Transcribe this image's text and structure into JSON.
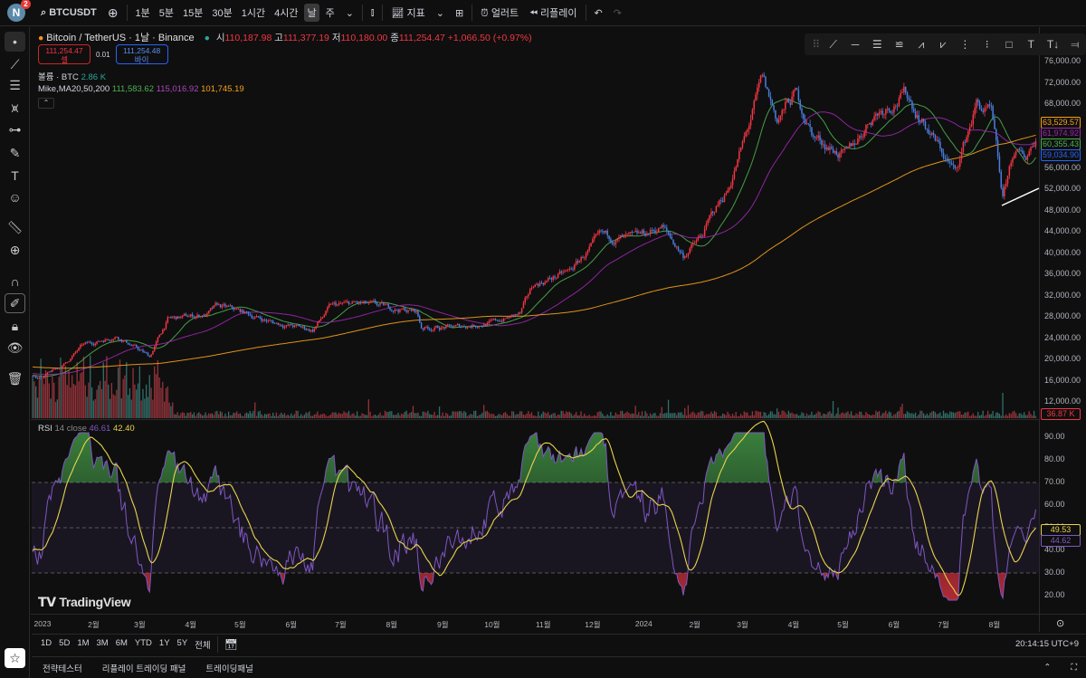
{
  "topbar": {
    "avatar_letter": "N",
    "notification_count": "2",
    "symbol": "BTCUSDT",
    "intervals": [
      "1분",
      "5분",
      "15분",
      "30분",
      "1시간",
      "4시간",
      "날",
      "주"
    ],
    "active_interval": "날",
    "indicators_label": "지표",
    "alert_label": "얼러트",
    "replay_label": "리플레이"
  },
  "legend": {
    "title": "Bitcoin / TetherUS · 1날 · Binance",
    "o_label": "시",
    "o": "110,187.98",
    "h_label": "고",
    "h": "111,377.19",
    "l_label": "저",
    "l": "110,180.00",
    "c_label": "종",
    "c": "111,254.47",
    "change": "+1,066.50 (+0.97%)",
    "sell_price": "111,254.47",
    "sell_label": "셀",
    "spread": "0.01",
    "buy_price": "111,254.48",
    "buy_label": "바이",
    "volume_label": "볼륨 · BTC",
    "volume_value": "2.86 K",
    "ma_label": "Mike,MA20,50,200",
    "ma20": "111,583.62",
    "ma50": "115,016.92",
    "ma200": "101,745.19",
    "rsi_label": "RSI",
    "rsi_params": "14 close",
    "rsi_value": "46.61",
    "rsi_ma_value": "42.40"
  },
  "price_axis": {
    "ticks": [
      "76,000.00",
      "72,000.00",
      "68,000.00",
      "64,000.00",
      "60,000.00",
      "56,000.00",
      "52,000.00",
      "48,000.00",
      "44,000.00",
      "40,000.00",
      "36,000.00",
      "32,000.00",
      "28,000.00",
      "24,000.00",
      "20,000.00",
      "16,000.00",
      "12,000.00"
    ],
    "tick_values": [
      76000,
      72000,
      68000,
      64000,
      60000,
      56000,
      52000,
      48000,
      44000,
      40000,
      36000,
      32000,
      28000,
      24000,
      20000,
      16000,
      12000
    ],
    "tags": [
      {
        "label": "63,529.57",
        "value": 63529.57,
        "color": "#f7a21b"
      },
      {
        "label": "61,974.92",
        "value": 61974.92,
        "color": "#9c27b0"
      },
      {
        "label": "60,355.43",
        "value": 60355.43,
        "color": "#4caf50"
      },
      {
        "label": "59,034.90",
        "value": 59034.9,
        "color": "#2962ff"
      }
    ],
    "volume_tag": "36.87 K"
  },
  "rsi_axis": {
    "ticks": [
      "90.00",
      "80.00",
      "70.00",
      "60.00",
      "50.00",
      "40.00",
      "30.00",
      "20.00"
    ],
    "tick_values": [
      90,
      80,
      70,
      60,
      50,
      40,
      30,
      20
    ],
    "tag_ma": "49.53",
    "tag_rsi": "44.62"
  },
  "time_axis": [
    {
      "label": "2023",
      "date": "2023-01-01"
    },
    {
      "label": "2월",
      "date": "2023-02-01"
    },
    {
      "label": "3월",
      "date": "2023-03-01"
    },
    {
      "label": "4월",
      "date": "2023-04-01"
    },
    {
      "label": "5월",
      "date": "2023-05-01"
    },
    {
      "label": "6월",
      "date": "2023-06-01"
    },
    {
      "label": "7월",
      "date": "2023-07-01"
    },
    {
      "label": "8월",
      "date": "2023-08-01"
    },
    {
      "label": "9월",
      "date": "2023-09-01"
    },
    {
      "label": "10월",
      "date": "2023-10-01"
    },
    {
      "label": "11월",
      "date": "2023-11-01"
    },
    {
      "label": "12월",
      "date": "2023-12-01"
    },
    {
      "label": "2024",
      "date": "2024-01-01"
    },
    {
      "label": "2월",
      "date": "2024-02-01"
    },
    {
      "label": "3월",
      "date": "2024-03-01"
    },
    {
      "label": "4월",
      "date": "2024-04-01"
    },
    {
      "label": "5월",
      "date": "2024-05-01"
    },
    {
      "label": "6월",
      "date": "2024-06-01"
    },
    {
      "label": "7월",
      "date": "2024-07-01"
    },
    {
      "label": "8월",
      "date": "2024-08-01"
    }
  ],
  "watermark": "TradingView",
  "ranges": [
    "1D",
    "5D",
    "1M",
    "3M",
    "6M",
    "YTD",
    "1Y",
    "5Y",
    "전체"
  ],
  "clock": "20:14:15 UTC+9",
  "bottom_tabs": [
    "전략테스터",
    "리플레이 트레이딩 패널",
    "트레이딩패널"
  ],
  "colors": {
    "up": "#f23645",
    "down": "#4a7fe0",
    "ma20": "#4caf50",
    "ma50": "#9c27b0",
    "ma200": "#f7a21b",
    "rsi": "#7e57c2",
    "rsi_ma": "#e8d44d"
  },
  "chart_data": {
    "type": "candlestick",
    "title": "Bitcoin / TetherUS · 1D · Binance",
    "note": "approximate daily price path (day offset from 2023-01-01, price USDT)",
    "price_path": [
      [
        -6,
        16800
      ],
      [
        0,
        16600
      ],
      [
        13,
        19000
      ],
      [
        24,
        22500
      ],
      [
        45,
        24500
      ],
      [
        65,
        20500
      ],
      [
        76,
        27500
      ],
      [
        100,
        28500
      ],
      [
        106,
        30000
      ],
      [
        120,
        29000
      ],
      [
        139,
        27000
      ],
      [
        164,
        25500
      ],
      [
        175,
        30000
      ],
      [
        191,
        30500
      ],
      [
        227,
        29000
      ],
      [
        230,
        26000
      ],
      [
        249,
        26000
      ],
      [
        274,
        27000
      ],
      [
        290,
        28500
      ],
      [
        298,
        34000
      ],
      [
        320,
        36500
      ],
      [
        339,
        43000
      ],
      [
        359,
        42500
      ],
      [
        376,
        45000
      ],
      [
        389,
        39500
      ],
      [
        400,
        43000
      ],
      [
        408,
        48000
      ],
      [
        416,
        52000
      ],
      [
        427,
        62000
      ],
      [
        437,
        72500
      ],
      [
        446,
        65000
      ],
      [
        457,
        70000
      ],
      [
        468,
        62000
      ],
      [
        488,
        58000
      ],
      [
        504,
        66000
      ],
      [
        524,
        70000
      ],
      [
        540,
        62000
      ],
      [
        554,
        55000
      ],
      [
        567,
        68000
      ],
      [
        576,
        66000
      ],
      [
        583,
        50000
      ],
      [
        589,
        58500
      ],
      [
        597,
        58000
      ],
      [
        603,
        62000
      ]
    ],
    "moving_averages": [
      20,
      50,
      200
    ],
    "rsi_period": 14,
    "rsi_levels": [
      70,
      50,
      30
    ],
    "ylim": [
      12000,
      76000
    ],
    "rsi_ylim": [
      20,
      90
    ]
  }
}
